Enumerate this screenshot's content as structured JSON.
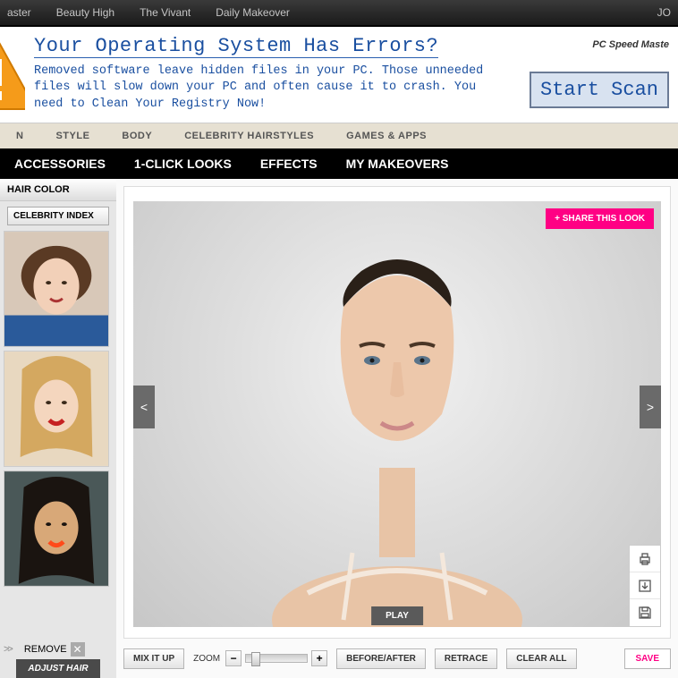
{
  "topbar": {
    "links": [
      "aster",
      "Beauty High",
      "The Vivant",
      "Daily Makeover"
    ],
    "right": "JO"
  },
  "ad": {
    "title": "Your Operating System Has Errors?",
    "body": "Removed software leave hidden files in your PC. Those unneeded files will slow down your PC and often cause it to crash. You need to Clean Your Registry Now!",
    "brand": "PC Speed Maste",
    "button": "Start Scan"
  },
  "nav1": [
    "N",
    "STYLE",
    "BODY",
    "CELEBRITY HAIRSTYLES",
    "GAMES & APPS"
  ],
  "nav2": [
    "ACCESSORIES",
    "1-CLICK LOOKS",
    "EFFECTS",
    "MY MAKEOVERS"
  ],
  "sidebar": {
    "title": "HAIR COLOR",
    "celeb_button": "CELEBRITY INDEX",
    "remove": {
      "arrows": ">>",
      "label": "REMOVE"
    },
    "adjust": "ADJUST HAIR"
  },
  "canvas": {
    "share": "+ SHARE THIS LOOK",
    "prev": "<",
    "next": ">",
    "play": "PLAY"
  },
  "toolbar": {
    "mix": "MIX IT UP",
    "zoom": "ZOOM",
    "before": "BEFORE/AFTER",
    "retrace": "RETRACE",
    "clear": "CLEAR ALL",
    "save": "SAVE"
  }
}
